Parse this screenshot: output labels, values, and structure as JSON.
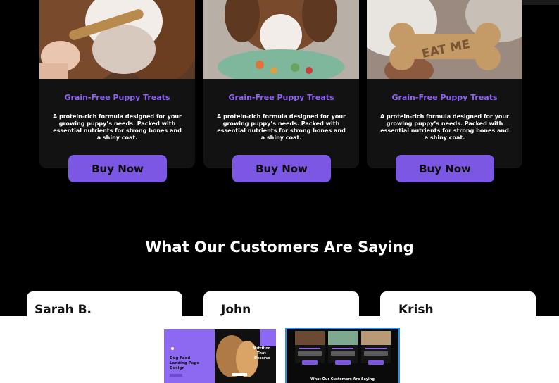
{
  "products": [
    {
      "title": "Grain-Free Puppy Treats",
      "description": "A protein-rich formula designed for your growing puppy’s needs. Packed with essential nutrients for strong bones and a shiny coat.",
      "button": "Buy Now",
      "image": "dog-chewing-stick-photo"
    },
    {
      "title": "Grain-Free Puppy Treats",
      "description": "A protein-rich formula designed for your growing puppy’s needs. Packed with essential nutrients for strong bones and a shiny coat.",
      "button": "Buy Now",
      "image": "dog-eating-from-puzzle-bowl-photo"
    },
    {
      "title": "Grain-Free Puppy Treats",
      "description": "A protein-rich formula designed for your growing puppy’s needs. Packed with essential nutrients for strong bones and a shiny coat.",
      "button": "Buy Now",
      "image": "bone-biscuit-eat-me-photo"
    }
  ],
  "bone_stamp": "EAT ME",
  "testimonials_heading": "What Our Customers Are Saying",
  "testimonials": [
    {
      "name": "Sarah B."
    },
    {
      "name": "John"
    },
    {
      "name": "Krish"
    }
  ],
  "thumbnails": [
    {
      "caption_lines": [
        "Dog Food",
        "Landing Page",
        "Design"
      ],
      "side_text": [
        "Nutrition",
        "That",
        "Deserve"
      ],
      "active": false
    },
    {
      "heading": "What Our Customers Are Saying",
      "active": true
    }
  ],
  "colors": {
    "accent": "#7b57e4",
    "title_accent": "#8e63ef",
    "background": "#000000",
    "card": "#121212",
    "thumb_border": "#2f8df0"
  }
}
